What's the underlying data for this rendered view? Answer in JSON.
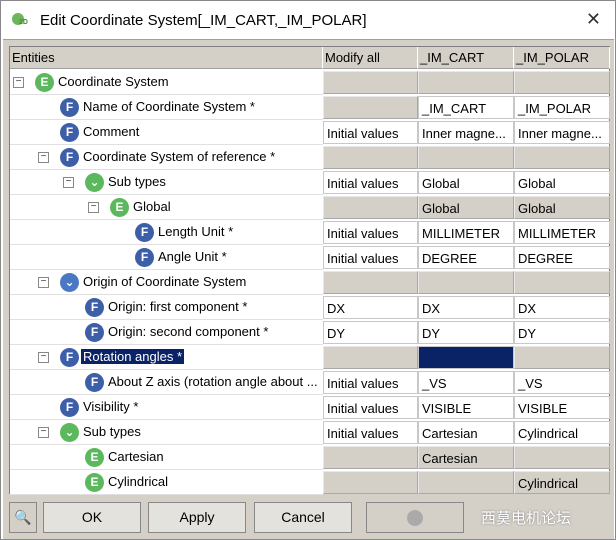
{
  "window": {
    "title": "Edit Coordinate System[_IM_CART,_IM_POLAR]",
    "close": "✕"
  },
  "columns": [
    "Entities",
    "Modify all",
    "_IM_CART",
    "_IM_POLAR"
  ],
  "rows": [
    {
      "label": "Coordinate System",
      "icon": "E",
      "level": 0,
      "exp": true,
      "cells": [
        [
          "g",
          ""
        ],
        [
          "g",
          ""
        ],
        [
          "g",
          ""
        ]
      ]
    },
    {
      "label": "Name of Coordinate System *",
      "icon": "F",
      "level": 1,
      "exp": false,
      "cells": [
        [
          "g",
          ""
        ],
        [
          "w",
          "_IM_CART"
        ],
        [
          "w",
          "_IM_POLAR"
        ]
      ]
    },
    {
      "label": "Comment",
      "icon": "F",
      "level": 1,
      "exp": false,
      "cells": [
        [
          "w",
          "Initial values"
        ],
        [
          "w",
          "Inner magne..."
        ],
        [
          "w",
          "Inner magne..."
        ]
      ]
    },
    {
      "label": "Coordinate System of reference *",
      "icon": "F",
      "level": 1,
      "exp": true,
      "cells": [
        [
          "g",
          ""
        ],
        [
          "g",
          ""
        ],
        [
          "g",
          ""
        ]
      ]
    },
    {
      "label": "Sub types",
      "icon": "Vg",
      "level": 2,
      "exp": true,
      "cells": [
        [
          "w",
          "Initial values"
        ],
        [
          "w",
          "Global"
        ],
        [
          "w",
          "Global"
        ]
      ]
    },
    {
      "label": "Global",
      "icon": "E",
      "level": 3,
      "exp": true,
      "cells": [
        [
          "g",
          ""
        ],
        [
          "g",
          "Global"
        ],
        [
          "g",
          "Global"
        ]
      ]
    },
    {
      "label": "Length Unit *",
      "icon": "F",
      "level": 4,
      "exp": false,
      "cells": [
        [
          "w",
          "Initial values"
        ],
        [
          "w",
          "MILLIMETER"
        ],
        [
          "w",
          "MILLIMETER"
        ]
      ]
    },
    {
      "label": "Angle Unit *",
      "icon": "F",
      "level": 4,
      "exp": false,
      "cells": [
        [
          "w",
          "Initial values"
        ],
        [
          "w",
          "DEGREE"
        ],
        [
          "w",
          "DEGREE"
        ]
      ]
    },
    {
      "label": "Origin of Coordinate System",
      "icon": "Vb",
      "level": 1,
      "exp": true,
      "cells": [
        [
          "g",
          ""
        ],
        [
          "g",
          ""
        ],
        [
          "g",
          ""
        ]
      ]
    },
    {
      "label": "Origin: first component *",
      "icon": "F",
      "level": 2,
      "exp": false,
      "cells": [
        [
          "w",
          "DX"
        ],
        [
          "w",
          "DX"
        ],
        [
          "w",
          "DX"
        ]
      ]
    },
    {
      "label": "Origin: second component *",
      "icon": "F",
      "level": 2,
      "exp": false,
      "cells": [
        [
          "w",
          "DY"
        ],
        [
          "w",
          "DY"
        ],
        [
          "w",
          "DY"
        ]
      ]
    },
    {
      "label": "Rotation angles *",
      "icon": "F",
      "level": 1,
      "exp": true,
      "selected": true,
      "cells": [
        [
          "g",
          ""
        ],
        [
          "sel",
          ""
        ],
        [
          "g",
          ""
        ]
      ]
    },
    {
      "label": "About Z axis (rotation angle about ...",
      "icon": "F",
      "level": 2,
      "exp": false,
      "cells": [
        [
          "w",
          "Initial values"
        ],
        [
          "w",
          "_VS"
        ],
        [
          "w",
          "_VS"
        ]
      ]
    },
    {
      "label": "Visibility *",
      "icon": "F",
      "level": 1,
      "exp": false,
      "cells": [
        [
          "w",
          "Initial values"
        ],
        [
          "w",
          "VISIBLE"
        ],
        [
          "w",
          "VISIBLE"
        ]
      ]
    },
    {
      "label": "Sub types",
      "icon": "Vg",
      "level": 1,
      "exp": true,
      "cells": [
        [
          "w",
          "Initial values"
        ],
        [
          "w",
          "Cartesian"
        ],
        [
          "w",
          "Cylindrical"
        ]
      ]
    },
    {
      "label": "Cartesian",
      "icon": "E",
      "level": 2,
      "exp": false,
      "cells": [
        [
          "g",
          ""
        ],
        [
          "g",
          "Cartesian"
        ],
        [
          "g",
          ""
        ]
      ]
    },
    {
      "label": "Cylindrical",
      "icon": "E",
      "level": 2,
      "exp": false,
      "cells": [
        [
          "g",
          ""
        ],
        [
          "g",
          ""
        ],
        [
          "g",
          "Cylindrical"
        ]
      ]
    }
  ],
  "buttons": {
    "ok": "OK",
    "apply": "Apply",
    "cancel": "Cancel"
  },
  "watermark": "西莫电机论坛",
  "colors": {
    "selection": "#0a2266",
    "readonly": "#d4d0c8"
  }
}
